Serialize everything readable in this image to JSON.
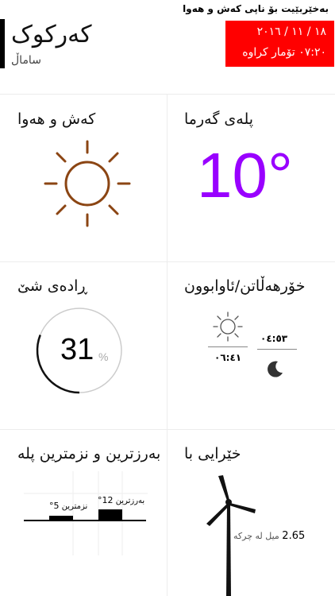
{
  "header": {
    "caption": "بەخێربێیت بۆ ناپی کەش و هەوا",
    "city": "کەرکوک",
    "region": "ساماڵ",
    "date": "١٨ / ١١ / ٢٠١٦",
    "updated": "٠٧:٢٠ تۆمار کراوە"
  },
  "cards": {
    "weather": {
      "title": "کەش و هەوا",
      "icon": "sun-icon",
      "icon_color": "#8b4513"
    },
    "temperature": {
      "title": "پلەی گەرما",
      "value": "10°",
      "color": "#9900ff"
    },
    "humidity": {
      "title": "ڕادەی شێ",
      "value": "31",
      "unit": "%",
      "level_percent": 31
    },
    "sun": {
      "title": "خۆرهەڵاتن/ئاوابوون",
      "sunrise": "٠٤:٥٣",
      "sunset": "٠٦:٤١"
    },
    "minmax": {
      "title": "بەرزترین و نزمترین پلە",
      "max_label": "بەرزترین",
      "max_value": "12°",
      "min_label": "نزمترین",
      "min_value": "5°"
    },
    "wind": {
      "title": "خێرایی با",
      "value": "2.65",
      "unit": "میل لە چرکە"
    }
  }
}
